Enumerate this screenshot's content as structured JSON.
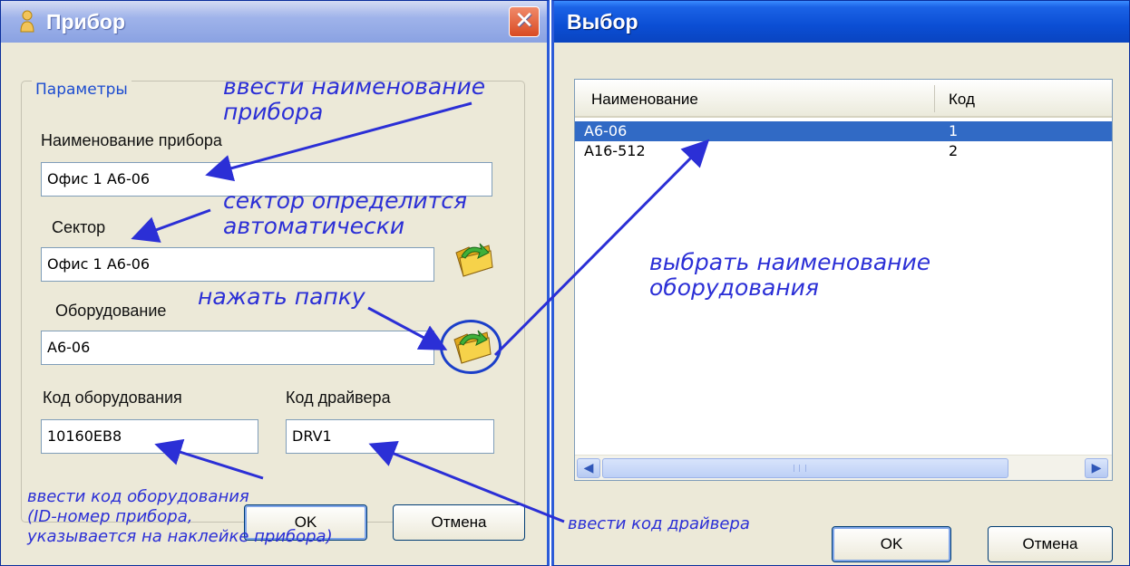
{
  "left_dialog": {
    "title": "Прибор",
    "close_glyph": "✕",
    "group_title": "Параметры",
    "device_name": {
      "label": "Наименование прибора",
      "value": "Офис 1 А6-06"
    },
    "sector": {
      "label": "Сектор",
      "value": "Офис 1 А6-06"
    },
    "equipment": {
      "label": "Оборудование",
      "value": "А6-06"
    },
    "equipment_code": {
      "label": "Код оборудования",
      "value": "10160EB8"
    },
    "driver_code": {
      "label": "Код драйвера",
      "value": "DRV1"
    },
    "ok_label": "OK",
    "cancel_label": "Отмена"
  },
  "right_dialog": {
    "title": "Выбор",
    "columns": [
      "Наименование",
      "Код"
    ],
    "rows": [
      {
        "name": "А6-06",
        "code": "1",
        "selected": true
      },
      {
        "name": "А16-512",
        "code": "2",
        "selected": false
      }
    ],
    "ok_label": "OK",
    "cancel_label": "Отмена"
  },
  "annotations": {
    "enter_name": [
      "ввести наименование",
      "прибора"
    ],
    "sector_auto": [
      "сектор определится",
      "автоматически"
    ],
    "press_folder": "нажать папку",
    "select_equipment": [
      "выбрать наименование",
      "оборудования"
    ],
    "enter_equipment_code": [
      "ввести код оборудования",
      "(ID-номер прибора,",
      "указывается на наклейке прибора)"
    ],
    "enter_driver_code": "ввести код драйвера"
  },
  "colors": {
    "annotation": "#2b2fd6",
    "selection": "#316ac5",
    "title_active": "#0b4ed4"
  },
  "icons": [
    "person-icon",
    "close-icon",
    "folder-open-icon",
    "scroll-left-icon",
    "scroll-right-icon"
  ]
}
